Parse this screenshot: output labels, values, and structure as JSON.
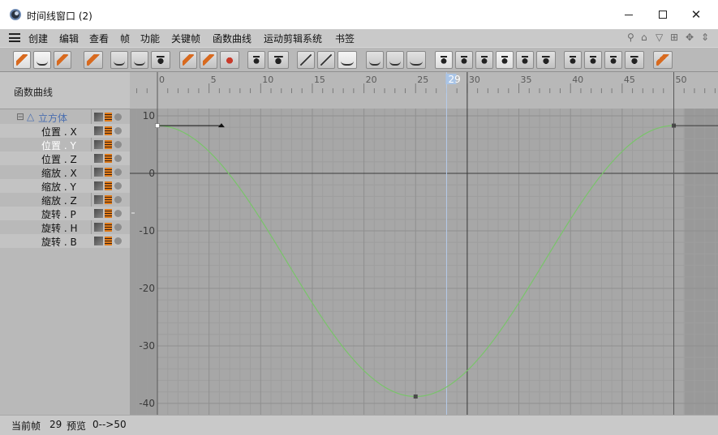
{
  "window": {
    "title": "时间线窗口 (2)"
  },
  "menu": {
    "items": [
      "创建",
      "编辑",
      "查看",
      "帧",
      "功能",
      "关键帧",
      "函数曲线",
      "运动剪辑系统",
      "书签"
    ]
  },
  "panel": {
    "header": "函数曲线",
    "root_object": "立方体",
    "tracks": [
      "位置 . X",
      "位置 . Y",
      "位置 . Z",
      "缩放 . X",
      "缩放 . Y",
      "缩放 . Z",
      "旋转 . P",
      "旋转 . H",
      "旋转 . B"
    ]
  },
  "timeline": {
    "frame_ticks": [
      "0",
      "5",
      "10",
      "15",
      "20",
      "25",
      "30",
      "35",
      "40",
      "45",
      "50"
    ],
    "current_frame_label": "29",
    "value_ticks": [
      "10",
      "0",
      "-10",
      "-20",
      "-30",
      "-40"
    ]
  },
  "status": {
    "current_frame_label": "当前帧",
    "current_frame": "29",
    "preview_label": "预览",
    "preview_range": "0-->50"
  },
  "colors": {
    "curve": "#79c46a",
    "playhead_marker": "#a9c4e6",
    "grid_bg": "#a9a9a9",
    "panel_bg": "#b9b9b9"
  }
}
